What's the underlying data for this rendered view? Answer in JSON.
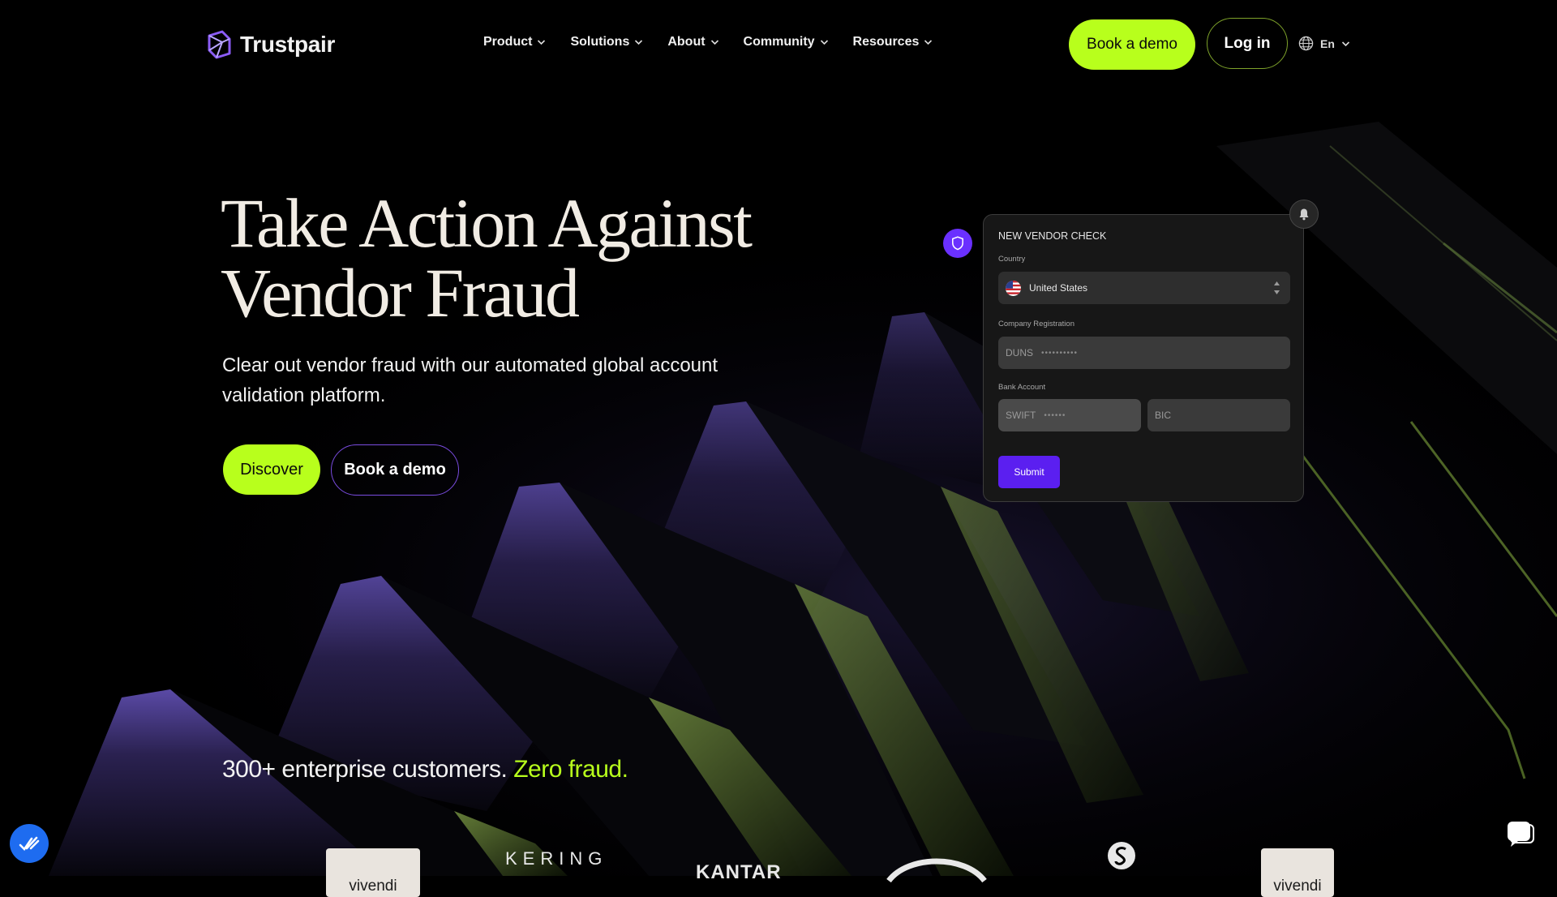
{
  "brand": {
    "name": "Trustpair"
  },
  "nav": {
    "items": [
      {
        "label": "Product"
      },
      {
        "label": "Solutions"
      },
      {
        "label": "About"
      },
      {
        "label": "Community"
      },
      {
        "label": "Resources"
      }
    ]
  },
  "header": {
    "book_demo_label": "Book a demo",
    "login_label": "Log in",
    "language_label": "En"
  },
  "hero": {
    "title_line1": "Take Action Against",
    "title_line2": "Vendor Fraud",
    "subtitle": "Clear out vendor fraud with our automated global account validation platform.",
    "discover_label": "Discover",
    "book_demo_label": "Book a demo"
  },
  "vendor_check": {
    "title": "NEW VENDOR CHECK",
    "country_label": "Country",
    "country_value": "United States",
    "company_reg_label": "Company Registration",
    "duns_placeholder": "DUNS",
    "duns_mask": "••••••••••",
    "bank_label": "Bank Account",
    "swift_placeholder": "SWIFT",
    "swift_mask": "••••••",
    "bic_placeholder": "BIC",
    "submit_label": "Submit"
  },
  "customers": {
    "headline": "300+ enterprise customers.",
    "accent": "Zero fraud.",
    "logos": [
      "vivendi",
      "KERING",
      "KANTAR",
      "vivendi"
    ]
  },
  "colors": {
    "accent_green": "#b8ff1c",
    "accent_purple": "#5b1ff0",
    "background": "#000000"
  }
}
